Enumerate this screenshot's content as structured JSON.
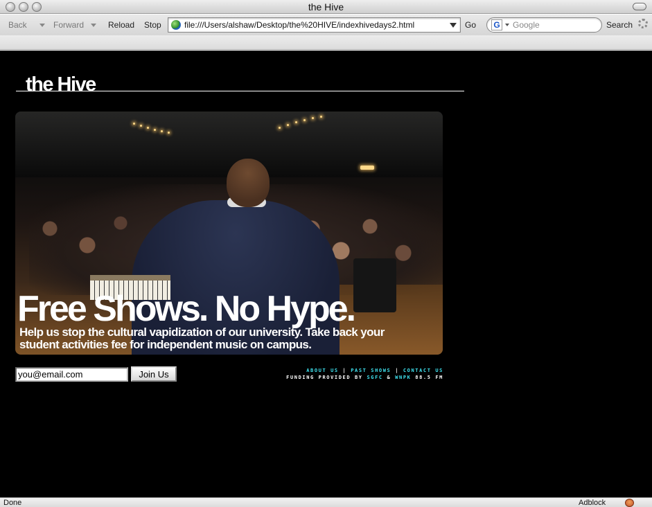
{
  "window": {
    "title": "the Hive"
  },
  "toolbar": {
    "back_label": "Back",
    "forward_label": "Forward",
    "reload_label": "Reload",
    "stop_label": "Stop",
    "url": "file:///Users/alshaw/Desktop/the%20HIVE/indexhivedays2.html",
    "go_label": "Go",
    "search_placeholder": "Google",
    "search_label": "Search",
    "search_engine_icon": "G"
  },
  "page": {
    "site_title": "the Hive",
    "hero": {
      "headline": "Free Shows.  No Hype.",
      "subtext": "Help us stop the cultural vapidization of our university.  Take back your student activities fee for independent music on campus."
    },
    "signup": {
      "email_value": "you@email.com",
      "join_label": "Join Us"
    },
    "footer": {
      "links": [
        "ABOUT US",
        "PAST SHOWS",
        "CONTACT US"
      ],
      "separator": "|",
      "funding_prefix": "FUNDING PROVIDED BY",
      "funder_1": "SGFC",
      "funding_amp": "&",
      "funder_2": "WNPK",
      "funding_suffix": "88.5 FM"
    }
  },
  "statusbar": {
    "status": "Done",
    "adblock_label": "Adblock"
  },
  "colors": {
    "page_bg": "#000000",
    "link_cyan": "#3fe3f0",
    "text_white": "#ffffff"
  },
  "icons": [
    "globe-icon",
    "google-icon",
    "spinner-icon",
    "adblock-icon"
  ]
}
